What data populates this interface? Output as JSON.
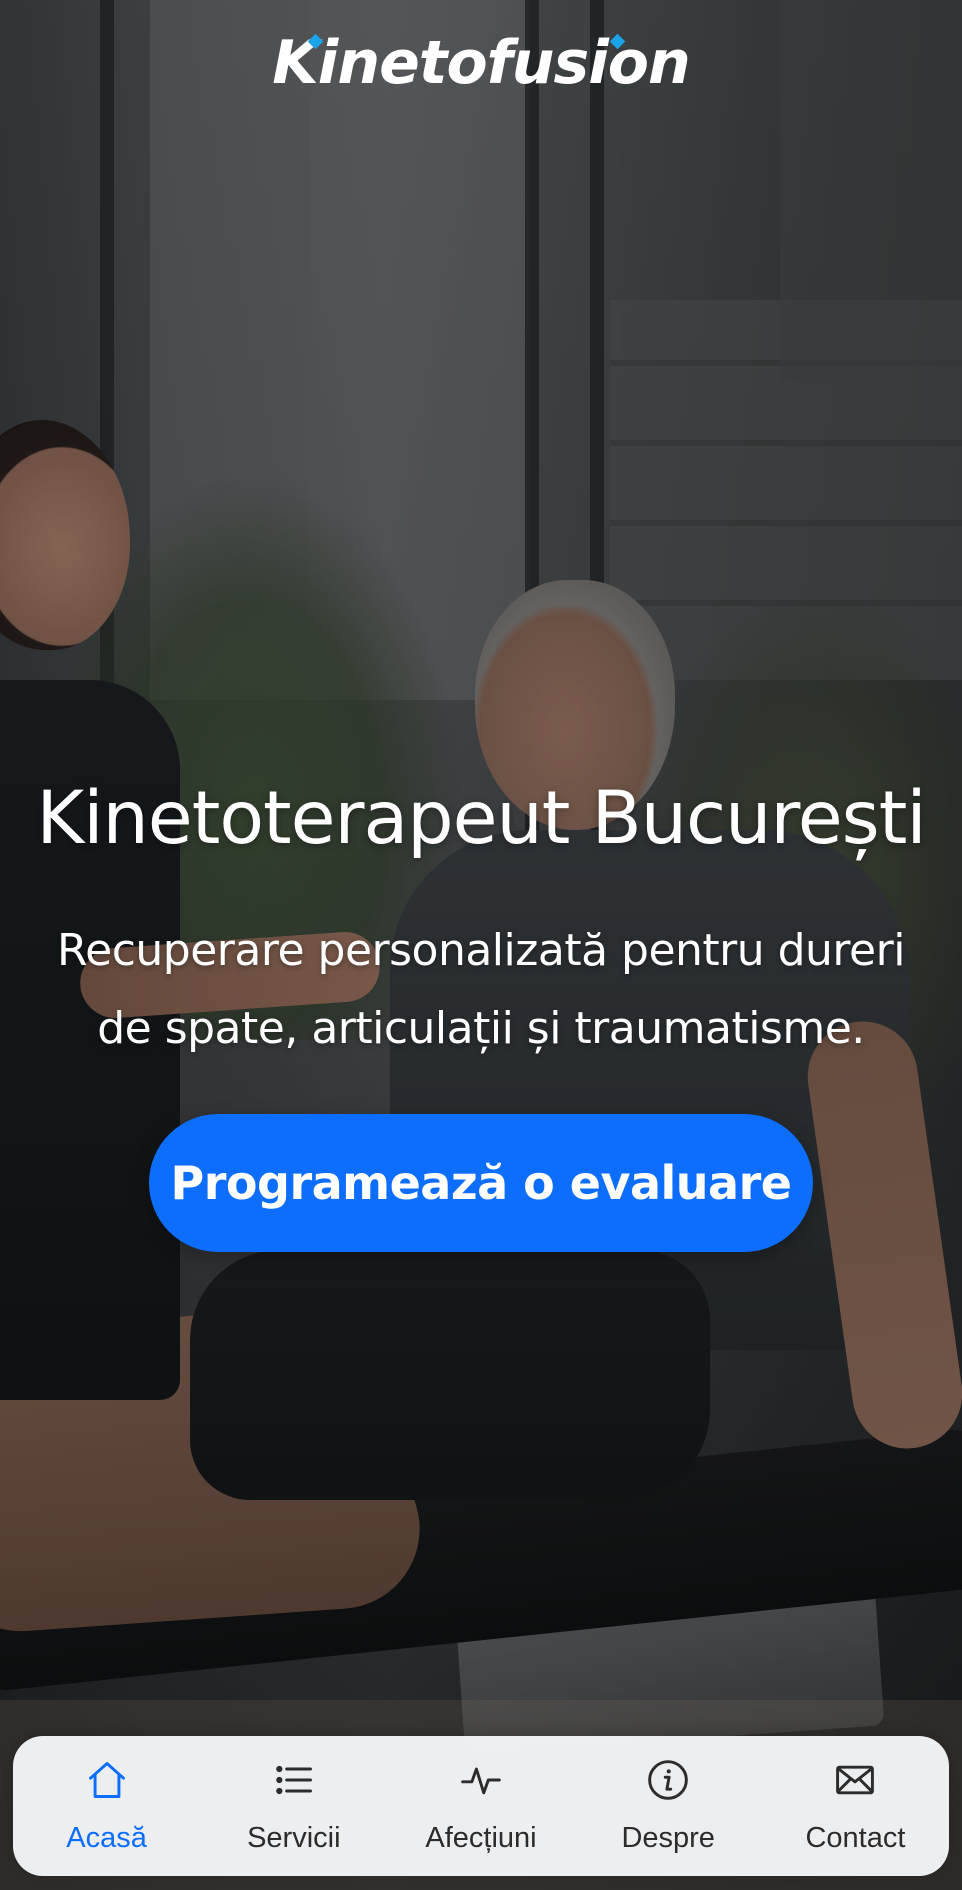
{
  "brand": {
    "logo_text": "Kinetofusion",
    "accent_color": "#1aa3e8"
  },
  "hero": {
    "title": "Kinetoterapeut București",
    "subtitle": "Recuperare personalizată pentru dureri de spate, articulații și traumatisme.",
    "cta_label": "Programează o evaluare",
    "cta_color": "#0d6efd"
  },
  "bottom_nav": {
    "active_color": "#0d6efd",
    "items": [
      {
        "label": "Acasă",
        "icon": "home-icon",
        "active": true
      },
      {
        "label": "Servicii",
        "icon": "list-icon",
        "active": false
      },
      {
        "label": "Afecțiuni",
        "icon": "pulse-icon",
        "active": false
      },
      {
        "label": "Despre",
        "icon": "info-icon",
        "active": false
      },
      {
        "label": "Contact",
        "icon": "mail-icon",
        "active": false
      }
    ]
  }
}
